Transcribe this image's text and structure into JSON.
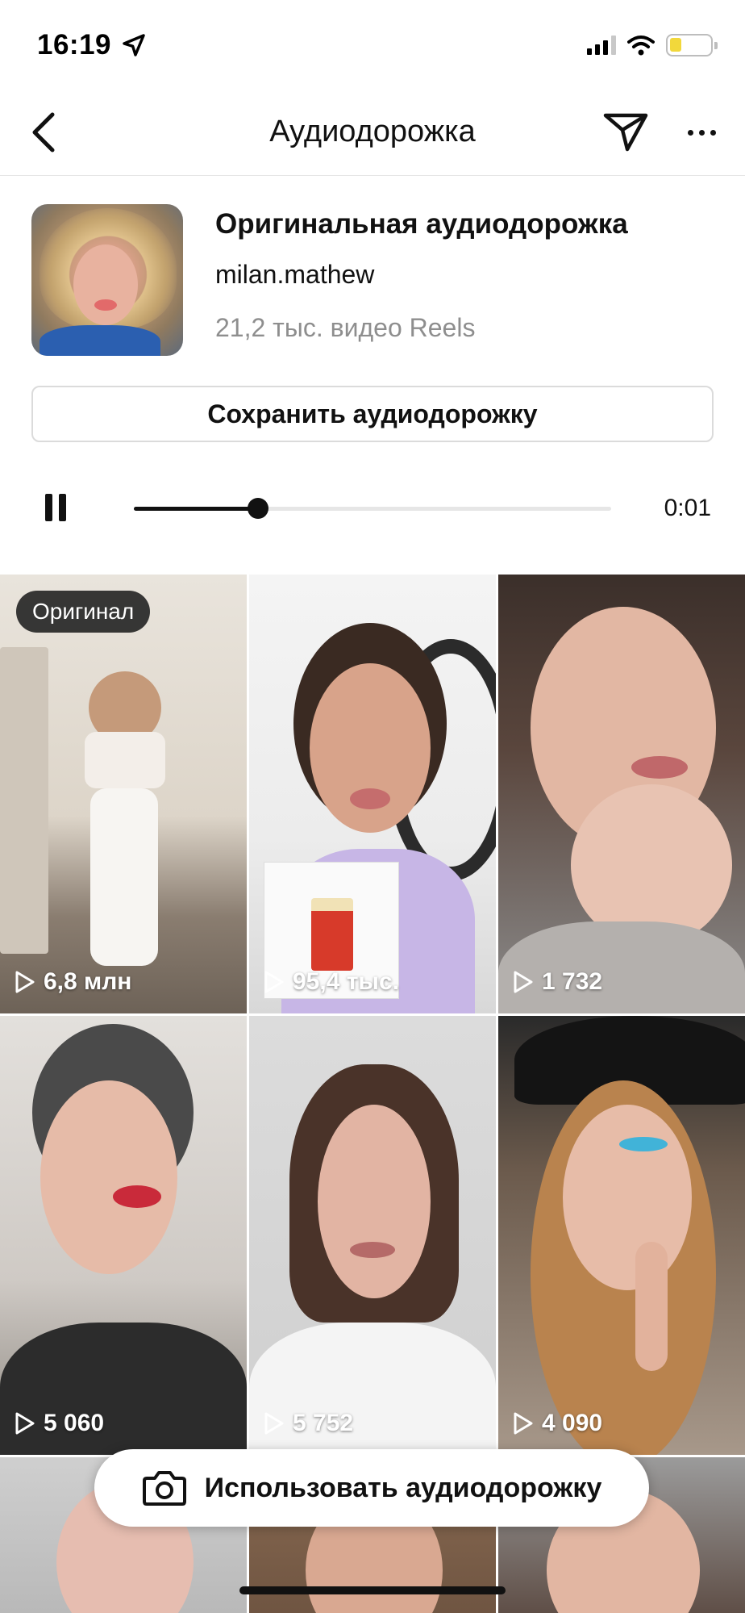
{
  "status_bar": {
    "time": "16:19"
  },
  "nav": {
    "title": "Аудиодорожка"
  },
  "audio": {
    "title": "Оригинальная аудиодорожка",
    "artist": "milan.mathew",
    "reels_count": "21,2 тыс. видео Reels",
    "save_label": "Сохранить аудиодорожку"
  },
  "player": {
    "time": "0:01",
    "progress": 0.26
  },
  "grid": {
    "original_badge": "Оригинал",
    "tiles": [
      {
        "views": "6,8 млн"
      },
      {
        "views": "95,4 тыс."
      },
      {
        "views": "1 732"
      },
      {
        "views": "5 060"
      },
      {
        "views": "5 752"
      },
      {
        "views": "4 090"
      }
    ]
  },
  "use_button": {
    "label": "Использовать аудиодорожку"
  },
  "colors": {
    "battery": "#f2d83b",
    "accent": "#111111",
    "muted": "#8e8e8e"
  }
}
